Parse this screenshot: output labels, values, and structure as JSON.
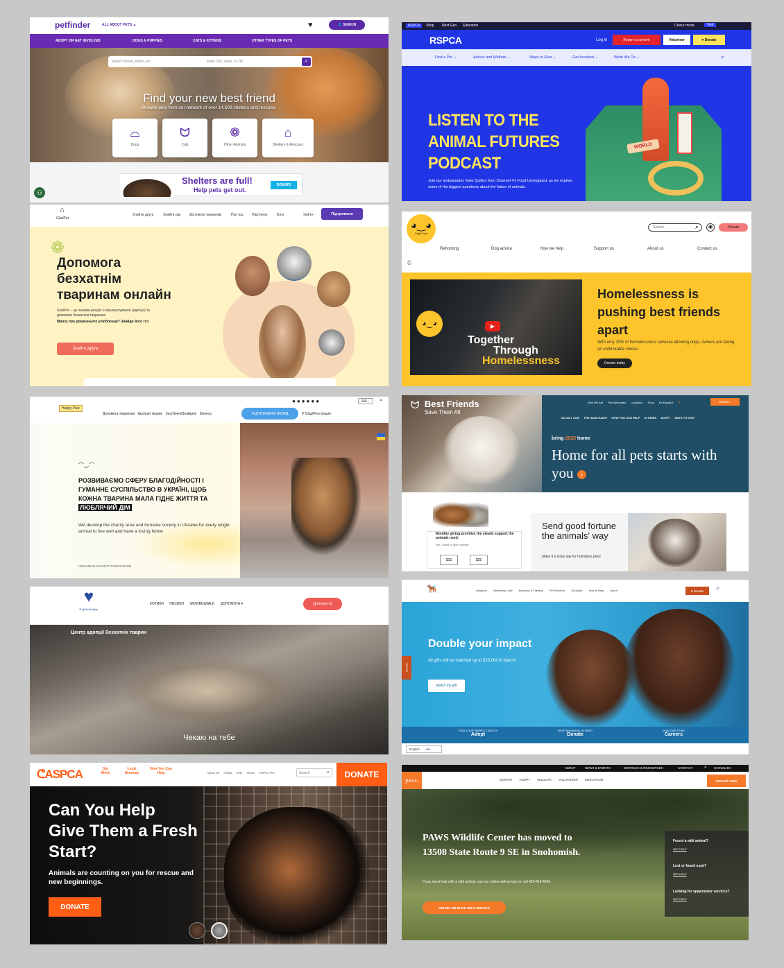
{
  "petfinder": {
    "logo": "petfinder",
    "about_menu": "ALL ABOUT PETS",
    "sign_in": "SIGN IN",
    "nav": [
      "ADOPT OR GET INVOLVED",
      "DOGS & PUPPIES",
      "CATS & KITTENS",
      "OTHER TYPES OF PETS"
    ],
    "search_placeholder": "Search Terrier, Kitten, etc",
    "location_placeholder": "Enter City, State, or ZIP",
    "hero_title": "Find your new best friend",
    "hero_subtitle": "Browse pets from our network of over 14,500 shelters and rescues.",
    "categories": [
      {
        "label": "Dogs",
        "icon": "dog-icon"
      },
      {
        "label": "Cats",
        "icon": "cat-icon"
      },
      {
        "label": "Other Animals",
        "icon": "paw-icon"
      },
      {
        "label": "Shelters & Rescues",
        "icon": "shelter-icon"
      }
    ],
    "ad_title": "Shelters are full!",
    "ad_subtitle": "Help pets get out.",
    "ad_button": "DONATE",
    "brand_color": "#5a2aa8"
  },
  "rspca": {
    "top_links": [
      "RSPCA",
      "Shop",
      "Next Gen",
      "Education"
    ],
    "top_right": [
      "Colour mode",
      "Visit"
    ],
    "logo": "RSPCA",
    "login": "Log in",
    "report": "Report a concern",
    "volunteer": "Volunteer",
    "donate": "Donate",
    "nav": [
      "Find a Pet",
      "Advice and Welfare",
      "Ways to Give",
      "Get Involved",
      "What We Do"
    ],
    "hero_lines": [
      "LISTEN TO THE",
      "ANIMAL FUTURES",
      "PODCAST"
    ],
    "hero_text": "Join our ambassador, Kate Quilton from Channel 4's Food Unwrapped, as we explore some of the biggest questions about the future of animals.",
    "blue": "#1f35e6",
    "yellow": "#ffe45c"
  },
  "gladpet": {
    "logo": "GladPet",
    "nav": [
      "Знайти друга",
      "Знайти дім",
      "Допомога тваринам",
      "Про нас",
      "Партнери",
      "Блог"
    ],
    "lang": "Увійти",
    "support": "Підтримати",
    "title_lines": [
      "Допомога",
      "безхатнім",
      "тваринам онлайн"
    ],
    "text": "GladPet – це онлайн-ресурс з прилаштування (адопції) та допомоги безхатнім тваринам.",
    "text_bold": "Мрієш про домашнього улюбленця? Знайди його тут.",
    "cta": "Знайти друга"
  },
  "dogstrust": {
    "logo": "DogsTrust",
    "search_placeholder": "Search",
    "donate": "Donate",
    "nav": [
      "Rehoming",
      "Dog advice",
      "How we help",
      "Support us",
      "About us",
      "Contact us"
    ],
    "video_lines": [
      "Together",
      "Through",
      "Homelessness"
    ],
    "title": "Homelessness is pushing best friends apart",
    "text": "With only 10% of homelessness services allowing dogs, owners are facing an unthinkable choice.",
    "cta": "Donate today",
    "yellow": "#fdc52b"
  },
  "happypaw": {
    "logo": "Happy Paw",
    "nav": [
      "Допомога тваринам",
      "Адопція тварин",
      "Загублені/Знайдені",
      "Бізнесу"
    ],
    "support": "ПІДТРИМАТИ ФОНД",
    "login": "Вхід/Реєстрація",
    "lang": "UA",
    "title_lines": [
      "РОЗВИВАЄМО СФЕРУ БЛАГОДІЙНОСТІ І",
      "ГУМАННЕ СУСПІЛЬСТВО В УКРАЇНІ, ЩОБ",
      "КОЖНА ТВАРИНА МАЛА ГІДНЕ ЖИТТЯ ТА"
    ],
    "title_highlight": "ЛЮБЛЯЧИЙ ДІМ",
    "subtitle": "We develop the charity area and humane society in Ukraine for every single animal to live well and have a loving home",
    "footer": "UKRAINIAN CHARITY FOUNDATION"
  },
  "bestfriends": {
    "logo_title": "Best Friends",
    "logo_sub": "Save Them All",
    "top_nav": [
      "Who We Are",
      "Pet Memorials",
      "Locations",
      "Shop",
      "En Español"
    ],
    "donate": "Donate",
    "nav": [
      "NO-KILL 2025",
      "THE SANCTUARY",
      "HOW YOU CAN HELP",
      "STORIES",
      "ADOPT",
      "WAYS TO GIVE"
    ],
    "kicker_pre": "bring",
    "kicker_year": "2025",
    "kicker_post": "home",
    "title": "Home for all pets starts with you",
    "monthly": "Monthly giving provides the steady support the animals need.",
    "monthly_sub": "Yes, I want to give monthly:",
    "amounts": [
      "$10",
      "$25"
    ],
    "promo_title": "Send good fortune the animals' way",
    "promo_text": "Make it a lucky day for homeless pets!",
    "teal": "#1f4e66"
  },
  "kotyky": {
    "logo": "Я Добрий Друг",
    "nav": [
      "КОТИКИ",
      "ПЕСИКИ",
      "WOWBIGWALK",
      "ДОПОМОГА"
    ],
    "donate": "Допомогти",
    "tagline": "Центр адопції безхатніх тварин",
    "caption": "Чекаю на тебе"
  },
  "aahs": {
    "nav": [
      "Adoption",
      "Veterinary Care",
      "Behavior & Training",
      "Pet Services",
      "Educator",
      "How to Help",
      "About"
    ],
    "donate": "Donate",
    "title": "Double your impact",
    "text": "All gifts will be matched up to $25,000 in March!",
    "cta": "Match my gift",
    "side_tab": "Donate",
    "bottom": [
      {
        "kicker": "FIND YOUR PERFECT MATCH",
        "label": "Adopt"
      },
      {
        "kicker": "HELP AN ANIMAL IN NEED",
        "label": "Donate"
      },
      {
        "kicker": "JOIN OUR TEAM",
        "label": "Careers"
      }
    ],
    "language": "English"
  },
  "aspca": {
    "logo": "ASPCA",
    "nav": [
      "Our Work",
      "Local Services",
      "How You Can Help"
    ],
    "links": [
      "About Us",
      "Adopt",
      "Vets",
      "News",
      "ASPCA Pro"
    ],
    "search": "Search",
    "donate": "DONATE",
    "title_lines": [
      "Can You Help",
      "Give Them a Fresh",
      "Start?"
    ],
    "subtitle": "Animals are counting on you for rescue and new beginnings.",
    "cta": "DONATE",
    "orange": "#ff5e14"
  },
  "paws": {
    "top": [
      "ABOUT",
      "NEWS & EVENTS",
      "SERVICES & RESOURCES",
      "CONTACT",
      "ENGLISH"
    ],
    "logo": "paws.",
    "nav": [
      "DONATE",
      "ADOPT",
      "WILDLIFE",
      "VOLUNTEER",
      "EDUCATION"
    ],
    "donate_now": "DONATE NOW",
    "title": "PAWS Wildlife Center has moved to 13508 State Route 9 SE in Snohomish.",
    "text": "If you need help with a wild animal, use our online self-service or call 425-412-4040.",
    "cta": "ONLINE WILDLIFE SELF-SERVICE",
    "side": [
      {
        "q": "Found a wild animal?",
        "a": "GET HELP"
      },
      {
        "q": "Lost or found a pet?",
        "a": "GET HELP"
      },
      {
        "q": "Looking for spay/neuter services?",
        "a": "GET HELP"
      }
    ]
  }
}
